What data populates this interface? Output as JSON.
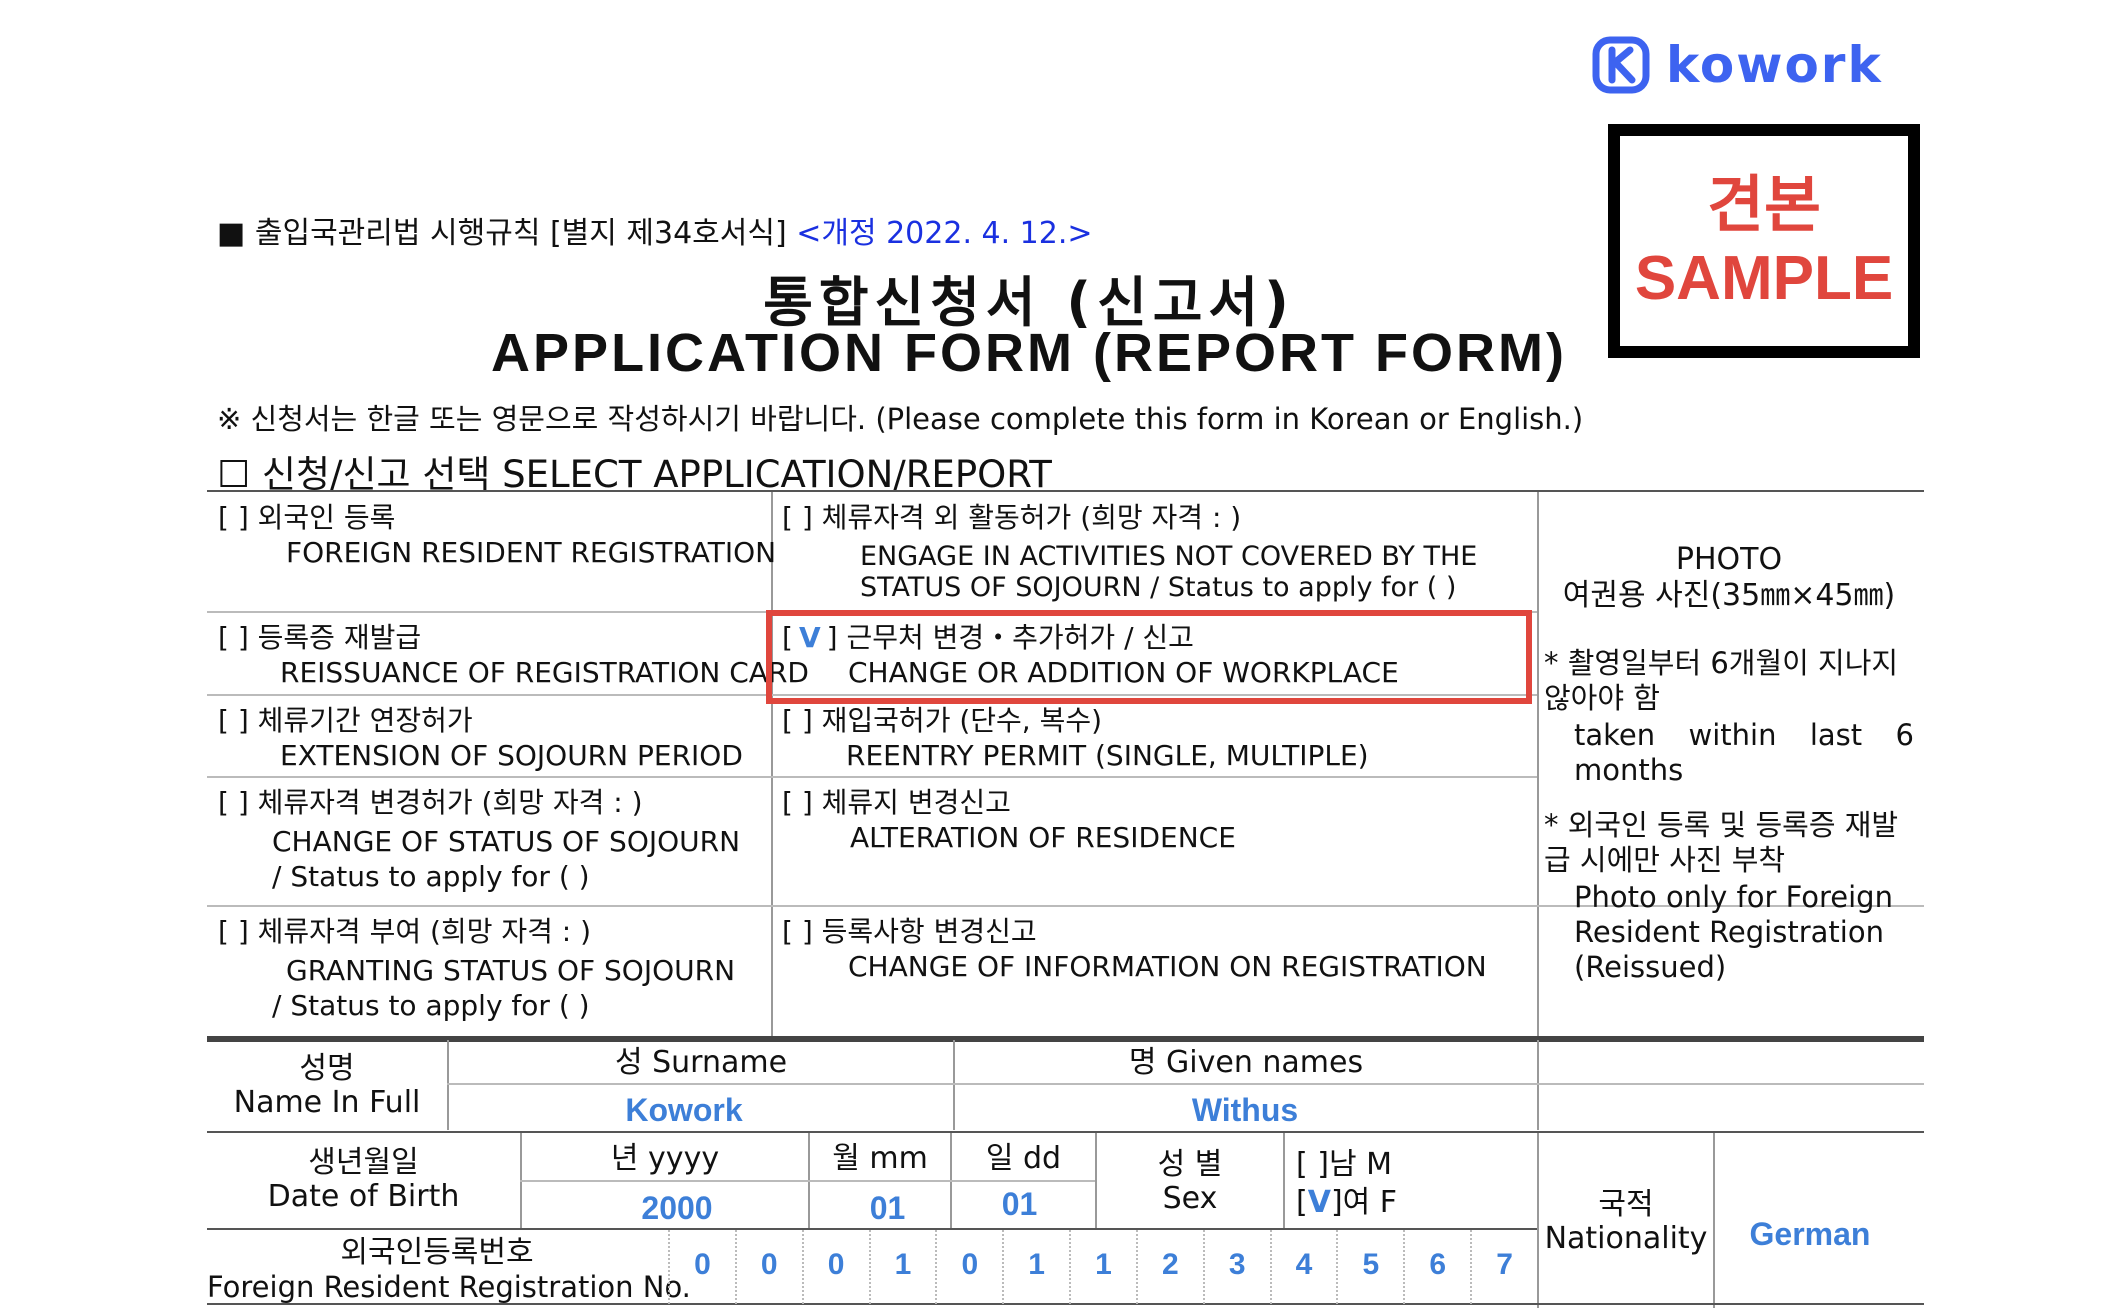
{
  "logo": {
    "text": "kowork",
    "icon": "kowork-k-logo-icon"
  },
  "stamp": {
    "ko": "견본",
    "en": "SAMPLE"
  },
  "header": {
    "rule": "■ 출입국관리법 시행규칙 [별지 제34호서식]",
    "revision": "<개정 2022. 4. 12.>",
    "title_ko": "통합신청서 (신고서)",
    "title_en": "APPLICATION FORM (REPORT FORM)",
    "note": "※ 신청서는 한글 또는 영문으로 작성하시기 바랍니다. (Please complete this form in Korean or English.)",
    "select_heading": "☐ 신청/신고 선택 SELECT APPLICATION/REPORT"
  },
  "options_left": [
    {
      "ko": "[  ] 외국인 등록",
      "en": "FOREIGN RESIDENT REGISTRATION"
    },
    {
      "ko": "[  ] 등록증 재발급",
      "en": "REISSUANCE OF REGISTRATION CARD"
    },
    {
      "ko": "[  ] 체류기간 연장허가",
      "en": "EXTENSION OF SOJOURN PERIOD"
    },
    {
      "ko": "[  ] 체류자격 변경허가  (희망 자격 :          )",
      "en": "CHANGE OF STATUS OF SOJOURN",
      "en2": "/ Status to apply for (              )"
    },
    {
      "ko": "[  ] 체류자격 부여        (희망 자격 :          )",
      "en": "GRANTING STATUS OF SOJOURN",
      "en2": "/ Status to apply for (              )"
    }
  ],
  "options_right": [
    {
      "ko": "[  ] 체류자격 외 활동허가  (희망 자격 :            )",
      "en": "ENGAGE IN ACTIVITIES NOT COVERED BY THE",
      "en2": "STATUS OF SOJOURN / Status to apply for (              )"
    },
    {
      "check": "V",
      "ko": "근무처 변경・추가허가 / 신고",
      "en": "CHANGE OR ADDITION OF WORKPLACE"
    },
    {
      "ko": "[  ] 재입국허가 (단수, 복수)",
      "en": "REENTRY PERMIT (SINGLE, MULTIPLE)"
    },
    {
      "ko": "[  ] 체류지 변경신고",
      "en": "ALTERATION OF RESIDENCE"
    },
    {
      "ko": "[  ] 등록사항 변경신고",
      "en": "CHANGE OF INFORMATION ON REGISTRATION"
    }
  ],
  "photo": {
    "title": "PHOTO",
    "subtitle": "여권용 사진(35㎜×45㎜)",
    "note1_ko": "* 촬영일부터 6개월이 지나지 않아야 함",
    "note1_en": "taken within last 6 months",
    "note2_ko": "* 외국인 등록 및 등록증 재발급 시에만 사진 부착",
    "note2_en": "Photo only for Foreign Resident Registration (Reissued)"
  },
  "name": {
    "label_ko": "성명",
    "label_en": "Name In Full",
    "surname_label": "성 Surname",
    "given_label": "명 Given names",
    "surname": "Kowork",
    "given": "Withus"
  },
  "birth": {
    "label_ko": "생년월일",
    "label_en": "Date of Birth",
    "year_label": "년 yyyy",
    "month_label": "월 mm",
    "day_label": "일 dd",
    "year": "2000",
    "month": "01",
    "day": "01"
  },
  "sex": {
    "label_ko": "성 별",
    "label_en": "Sex",
    "male": "[  ]남 M",
    "female_check": "V",
    "female": "여 F"
  },
  "nationality": {
    "label_ko": "국적",
    "label_en": "Nationality",
    "value": "German"
  },
  "registration": {
    "label_ko": "외국인등록번호",
    "label_en": "Foreign Resident Registration No.",
    "digits": [
      "0",
      "0",
      "0",
      "1",
      "0",
      "1",
      "1",
      "2",
      "3",
      "4",
      "5",
      "6",
      "7"
    ]
  }
}
